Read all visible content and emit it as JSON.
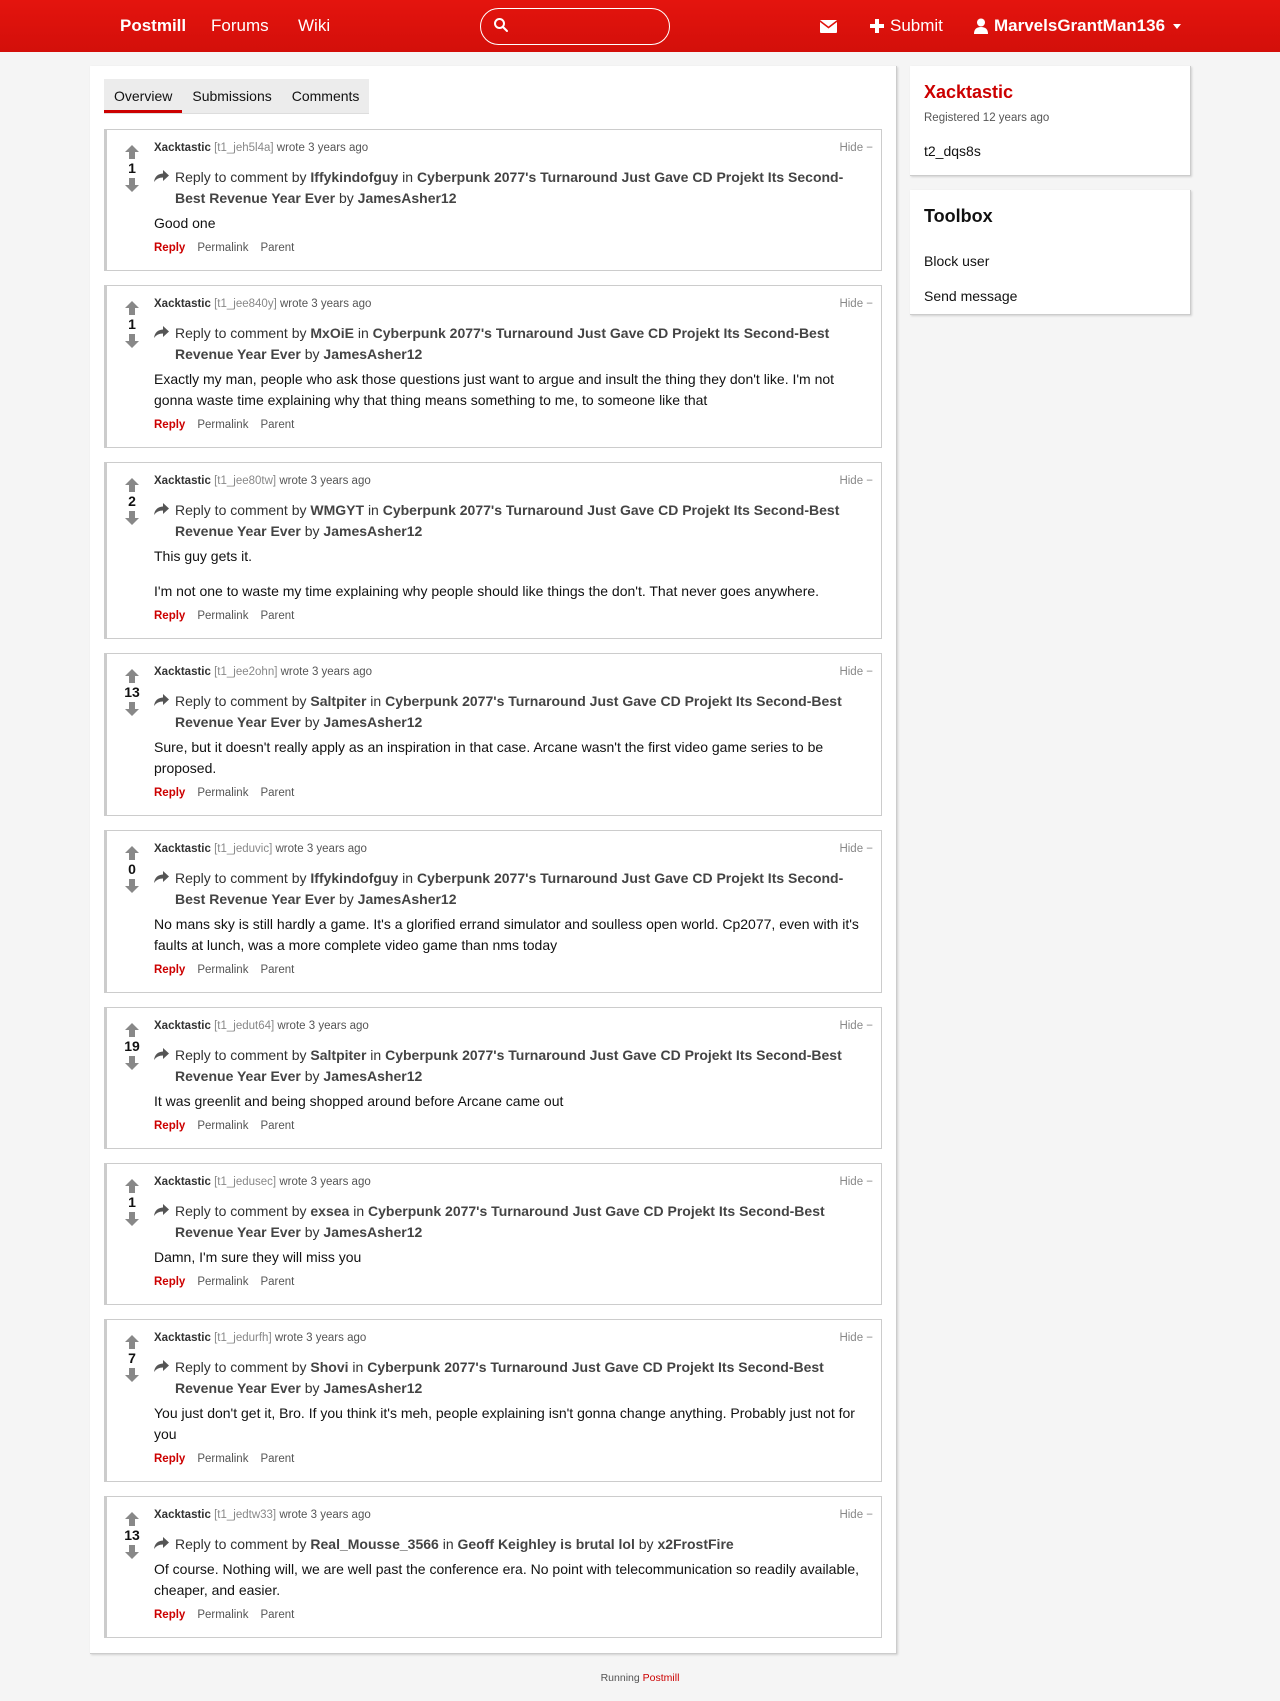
{
  "nav": {
    "brand": "Postmill",
    "forums": "Forums",
    "wiki": "Wiki",
    "search_placeholder": "",
    "submit": "Submit",
    "username": "MarvelsGrantMan136"
  },
  "tabs": [
    {
      "label": "Overview"
    },
    {
      "label": "Submissions"
    },
    {
      "label": "Comments"
    }
  ],
  "comments": [
    {
      "score": "1",
      "author": "Xacktastic",
      "id": "[t1_jeh5l4a]",
      "when": "wrote 3 years ago",
      "hide": "Hide −",
      "reply_prefix": "Reply to comment by",
      "parent_author": "Iffykindofguy",
      "in_word": "in",
      "post_title": "Cyberpunk 2077's Turnaround Just Gave CD Projekt Its Second-Best Revenue Year Ever",
      "by_word": "by",
      "post_author": "JamesAsher12",
      "body": [
        "Good one"
      ]
    },
    {
      "score": "1",
      "author": "Xacktastic",
      "id": "[t1_jee840y]",
      "when": "wrote 3 years ago",
      "hide": "Hide −",
      "reply_prefix": "Reply to comment by",
      "parent_author": "MxOiE",
      "in_word": "in",
      "post_title": "Cyberpunk 2077's Turnaround Just Gave CD Projekt Its Second-Best Revenue Year Ever",
      "by_word": "by",
      "post_author": "JamesAsher12",
      "body": [
        "Exactly my man, people who ask those questions just want to argue and insult the thing they don't like. I'm not gonna waste time explaining why that thing means something to me, to someone like that"
      ]
    },
    {
      "score": "2",
      "author": "Xacktastic",
      "id": "[t1_jee80tw]",
      "when": "wrote 3 years ago",
      "hide": "Hide −",
      "reply_prefix": "Reply to comment by",
      "parent_author": "WMGYT",
      "in_word": "in",
      "post_title": "Cyberpunk 2077's Turnaround Just Gave CD Projekt Its Second-Best Revenue Year Ever",
      "by_word": "by",
      "post_author": "JamesAsher12",
      "body": [
        "This guy gets it.",
        "I'm not one to waste my time explaining why people should like things the don't. That never goes anywhere."
      ]
    },
    {
      "score": "13",
      "author": "Xacktastic",
      "id": "[t1_jee2ohn]",
      "when": "wrote 3 years ago",
      "hide": "Hide −",
      "reply_prefix": "Reply to comment by",
      "parent_author": "Saltpiter",
      "in_word": "in",
      "post_title": "Cyberpunk 2077's Turnaround Just Gave CD Projekt Its Second-Best Revenue Year Ever",
      "by_word": "by",
      "post_author": "JamesAsher12",
      "body": [
        "Sure, but it doesn't really apply as an inspiration in that case. Arcane wasn't the first video game series to be proposed."
      ]
    },
    {
      "score": "0",
      "author": "Xacktastic",
      "id": "[t1_jeduvic]",
      "when": "wrote 3 years ago",
      "hide": "Hide −",
      "reply_prefix": "Reply to comment by",
      "parent_author": "Iffykindofguy",
      "in_word": "in",
      "post_title": "Cyberpunk 2077's Turnaround Just Gave CD Projekt Its Second-Best Revenue Year Ever",
      "by_word": "by",
      "post_author": "JamesAsher12",
      "body": [
        "No mans sky is still hardly a game. It's a glorified errand simulator and soulless open world. Cp2077, even with it's faults at lunch, was a more complete video game than nms today"
      ]
    },
    {
      "score": "19",
      "author": "Xacktastic",
      "id": "[t1_jedut64]",
      "when": "wrote 3 years ago",
      "hide": "Hide −",
      "reply_prefix": "Reply to comment by",
      "parent_author": "Saltpiter",
      "in_word": "in",
      "post_title": "Cyberpunk 2077's Turnaround Just Gave CD Projekt Its Second-Best Revenue Year Ever",
      "by_word": "by",
      "post_author": "JamesAsher12",
      "body": [
        "It was greenlit and being shopped around before Arcane came out"
      ]
    },
    {
      "score": "1",
      "author": "Xacktastic",
      "id": "[t1_jedusec]",
      "when": "wrote 3 years ago",
      "hide": "Hide −",
      "reply_prefix": "Reply to comment by",
      "parent_author": "exsea",
      "in_word": "in",
      "post_title": "Cyberpunk 2077's Turnaround Just Gave CD Projekt Its Second-Best Revenue Year Ever",
      "by_word": "by",
      "post_author": "JamesAsher12",
      "body": [
        "Damn, I'm sure they will miss you"
      ]
    },
    {
      "score": "7",
      "author": "Xacktastic",
      "id": "[t1_jedurfh]",
      "when": "wrote 3 years ago",
      "hide": "Hide −",
      "reply_prefix": "Reply to comment by",
      "parent_author": "Shovi",
      "in_word": "in",
      "post_title": "Cyberpunk 2077's Turnaround Just Gave CD Projekt Its Second-Best Revenue Year Ever",
      "by_word": "by",
      "post_author": "JamesAsher12",
      "body": [
        "You just don't get it, Bro. If you think it's meh, people explaining isn't gonna change anything. Probably just not for you"
      ]
    },
    {
      "score": "13",
      "author": "Xacktastic",
      "id": "[t1_jedtw33]",
      "when": "wrote 3 years ago",
      "hide": "Hide −",
      "reply_prefix": "Reply to comment by",
      "parent_author": "Real_Mousse_3566",
      "in_word": "in",
      "post_title": "Geoff Keighley is brutal lol",
      "by_word": "by",
      "post_author": "x2FrostFire",
      "body": [
        "Of course. Nothing will, we are well past the conference era. No point with telecommunication so readily available, cheaper, and easier."
      ]
    }
  ],
  "actions": {
    "reply": "Reply",
    "permalink": "Permalink",
    "parent": "Parent"
  },
  "profile": {
    "name": "Xacktastic",
    "registered": "Registered 12 years ago",
    "id": "t2_dqs8s"
  },
  "toolbox": {
    "title": "Toolbox",
    "block": "Block user",
    "message": "Send message"
  },
  "footer": {
    "prefix": "Running",
    "link": "Postmill"
  },
  "colors": {
    "accent": "#cc0000",
    "navbar": "#e0120c"
  }
}
